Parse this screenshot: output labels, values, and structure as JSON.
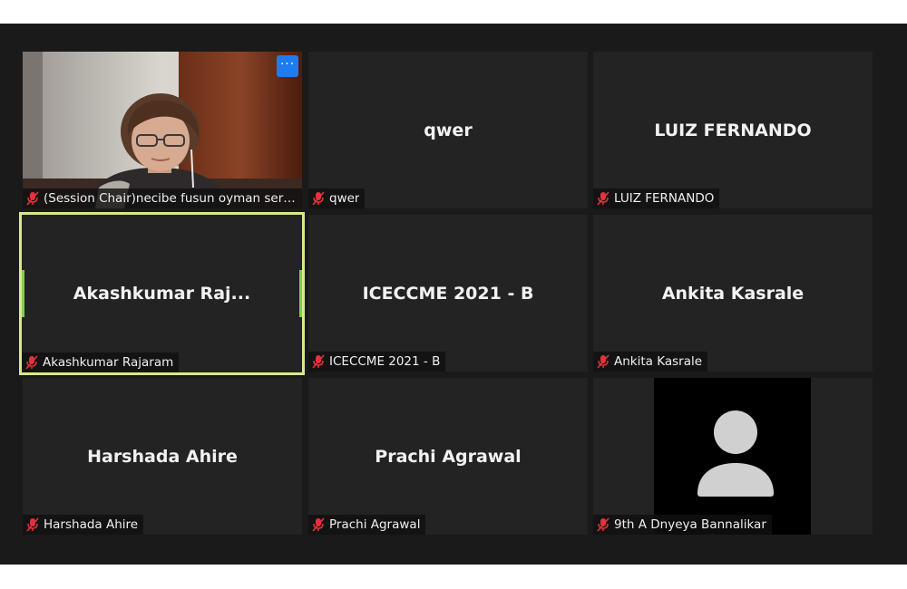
{
  "colors": {
    "stage_bg": "#1a1a1a",
    "tile_bg": "#232323",
    "active_border": "#dbe88a",
    "muted_icon": "#e3323b",
    "more_button": "#1f7cf0"
  },
  "participants": [
    {
      "tile_name": "",
      "label": "(Session Chair)necibe fusun oyman sertel...",
      "video": true,
      "muted": true,
      "has_more_menu": true,
      "more_glyph": "···"
    },
    {
      "tile_name": "qwer",
      "label": "qwer",
      "muted": true
    },
    {
      "tile_name": "LUIZ FERNANDO",
      "label": "LUIZ FERNANDO",
      "muted": true
    },
    {
      "tile_name": "Akashkumar  Raj...",
      "label": "Akashkumar Rajaram",
      "muted": true,
      "active_speaker": true
    },
    {
      "tile_name": "ICECCME 2021 - B",
      "label": "ICECCME 2021 - B",
      "muted": true
    },
    {
      "tile_name": "Ankita Kasrale",
      "label": "Ankita Kasrale",
      "muted": true
    },
    {
      "tile_name": "Harshada Ahire",
      "label": "Harshada Ahire",
      "muted": true
    },
    {
      "tile_name": "Prachi Agrawal",
      "label": "Prachi Agrawal",
      "muted": true
    },
    {
      "tile_name": "",
      "label": "9th A Dnyeya Bannalikar",
      "muted": true,
      "avatar_placeholder": true
    }
  ]
}
